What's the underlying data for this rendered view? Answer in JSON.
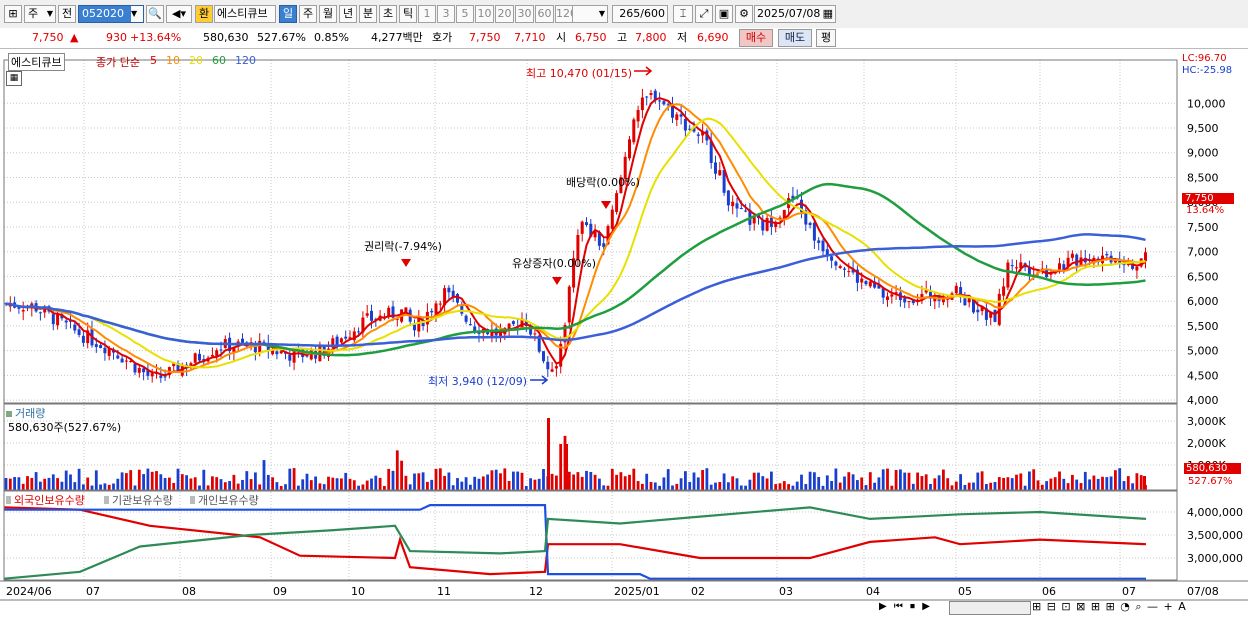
{
  "toolbar": {
    "period": "주",
    "type_select": "전",
    "code": "052020",
    "mode_badge": "환",
    "stock_name": "에스티큐브",
    "timeframes": [
      "일",
      "주",
      "월",
      "년",
      "분",
      "초",
      "틱"
    ],
    "intervals": [
      "1",
      "3",
      "5",
      "10",
      "20",
      "30",
      "60",
      "120"
    ],
    "count": "265",
    "count_total": "/600",
    "date": "2025/07/08"
  },
  "quote": {
    "price": "7,750",
    "change": "930",
    "change_pct": "+13.64%",
    "volume": "580,630",
    "volume_ratio": "527.67%",
    "turnover": "0.85%",
    "amount": "4,277백만",
    "bid_label": "호가",
    "ask": "7,750",
    "bid": "7,710",
    "open_label": "시",
    "open": "6,750",
    "high_label": "고",
    "high": "7,800",
    "low_label": "저",
    "low": "6,690",
    "buy": "매수",
    "sell": "매도",
    "avg": "평"
  },
  "legend": {
    "name": "에스티큐브",
    "ma_label": "종가 단순",
    "ma": [
      {
        "period": "5",
        "color": "#e00000"
      },
      {
        "period": "10",
        "color": "#ff8c00"
      },
      {
        "period": "20",
        "color": "#e8e000"
      },
      {
        "period": "60",
        "color": "#1e9e3e"
      },
      {
        "period": "120",
        "color": "#3a5fd8"
      }
    ]
  },
  "price_axis": {
    "ticks": [
      "10,000",
      "9,500",
      "9,000",
      "8,500",
      "8,000",
      "7,500",
      "7,000",
      "6,500",
      "6,000",
      "5,500",
      "5,000",
      "4,500",
      "4,000"
    ],
    "lc": "LC:96.70",
    "hc": "HC:-25.98",
    "current": "7,750",
    "current_pct": "13.64%"
  },
  "annotations": {
    "high": "최고 10,470 (01/15)",
    "low": "최저 3,940 (12/09)",
    "rights": "권리락(-7.94%)",
    "capital_increase": "유상증자(0.00%)",
    "ex_dividend": "배당락(0.00%)"
  },
  "volume_panel": {
    "title": "거래량",
    "value": "580,630주(527.67%)",
    "ticks": [
      "3,000K",
      "2,000K",
      "1,000K"
    ],
    "current": "580,630",
    "current_pct": "527.67%"
  },
  "holdings_panel": {
    "legend": [
      "외국인보유수량",
      "기관보유수량",
      "개인보유수량"
    ],
    "ticks": [
      "4,000,000",
      "3,500,000",
      "3,000,000"
    ]
  },
  "x_axis": [
    "2024/06",
    "07",
    "08",
    "09",
    "10",
    "11",
    "12",
    "2025/01",
    "02",
    "03",
    "04",
    "05",
    "06",
    "07",
    "07/08"
  ],
  "colors": {
    "up": "#e00000",
    "down": "#1a3fcf",
    "ma5": "#e00000",
    "ma10": "#ff8c00",
    "ma20": "#e8e000",
    "ma60": "#1e9e3e",
    "ma120": "#3a5fd8",
    "foreign": "#e00000",
    "inst": "#1e50e0",
    "indiv": "#2e8b57"
  }
}
